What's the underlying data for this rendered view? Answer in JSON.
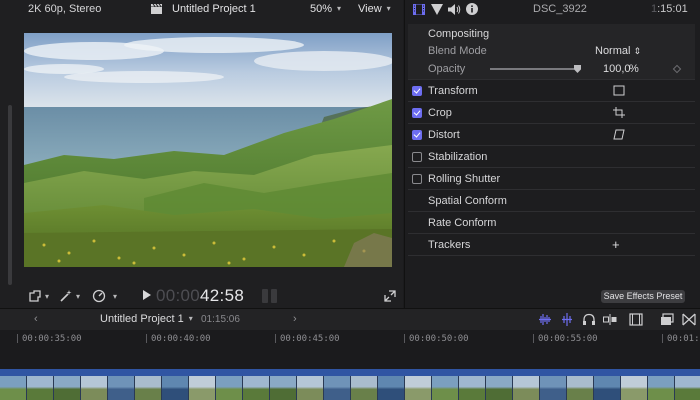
{
  "viewer": {
    "format": "2K 60p, Stereo",
    "project_title": "Untitled Project 1",
    "zoom": "50%",
    "view_menu": "View",
    "timecode_dim": "00:00",
    "timecode_bright": "42:58"
  },
  "inspector": {
    "tabs": [
      "video-icon",
      "color-icon",
      "audio-icon",
      "info-icon"
    ],
    "clip_name": "DSC_3922",
    "clip_time_dim": "1",
    "clip_time": ":15:01",
    "compositing": {
      "title": "Compositing",
      "blend_mode_label": "Blend Mode",
      "blend_mode_value": "Normal",
      "opacity_label": "Opacity",
      "opacity_value": "100,0",
      "opacity_unit": "%",
      "opacity_fraction": 1.0
    },
    "effects": [
      {
        "label": "Transform",
        "checked": true,
        "icon": "transform-icon"
      },
      {
        "label": "Crop",
        "checked": true,
        "icon": "crop-icon"
      },
      {
        "label": "Distort",
        "checked": true,
        "icon": "distort-icon"
      },
      {
        "label": "Stabilization",
        "checked": false
      },
      {
        "label": "Rolling Shutter",
        "checked": false
      },
      {
        "label": "Spatial Conform"
      },
      {
        "label": "Rate Conform"
      },
      {
        "label": "Trackers",
        "action": "+"
      }
    ],
    "save_preset_label": "Save Effects Preset"
  },
  "timeline": {
    "project_title": "Untitled Project 1",
    "duration": "01:15:06",
    "ruler": [
      "00:00:35:00",
      "00:00:40:00",
      "00:00:45:00",
      "00:00:50:00",
      "00:00:55:00",
      "00:01:"
    ]
  },
  "colors": {
    "accent": "#6d6df0",
    "filmstrip_header": "#3055a3"
  }
}
